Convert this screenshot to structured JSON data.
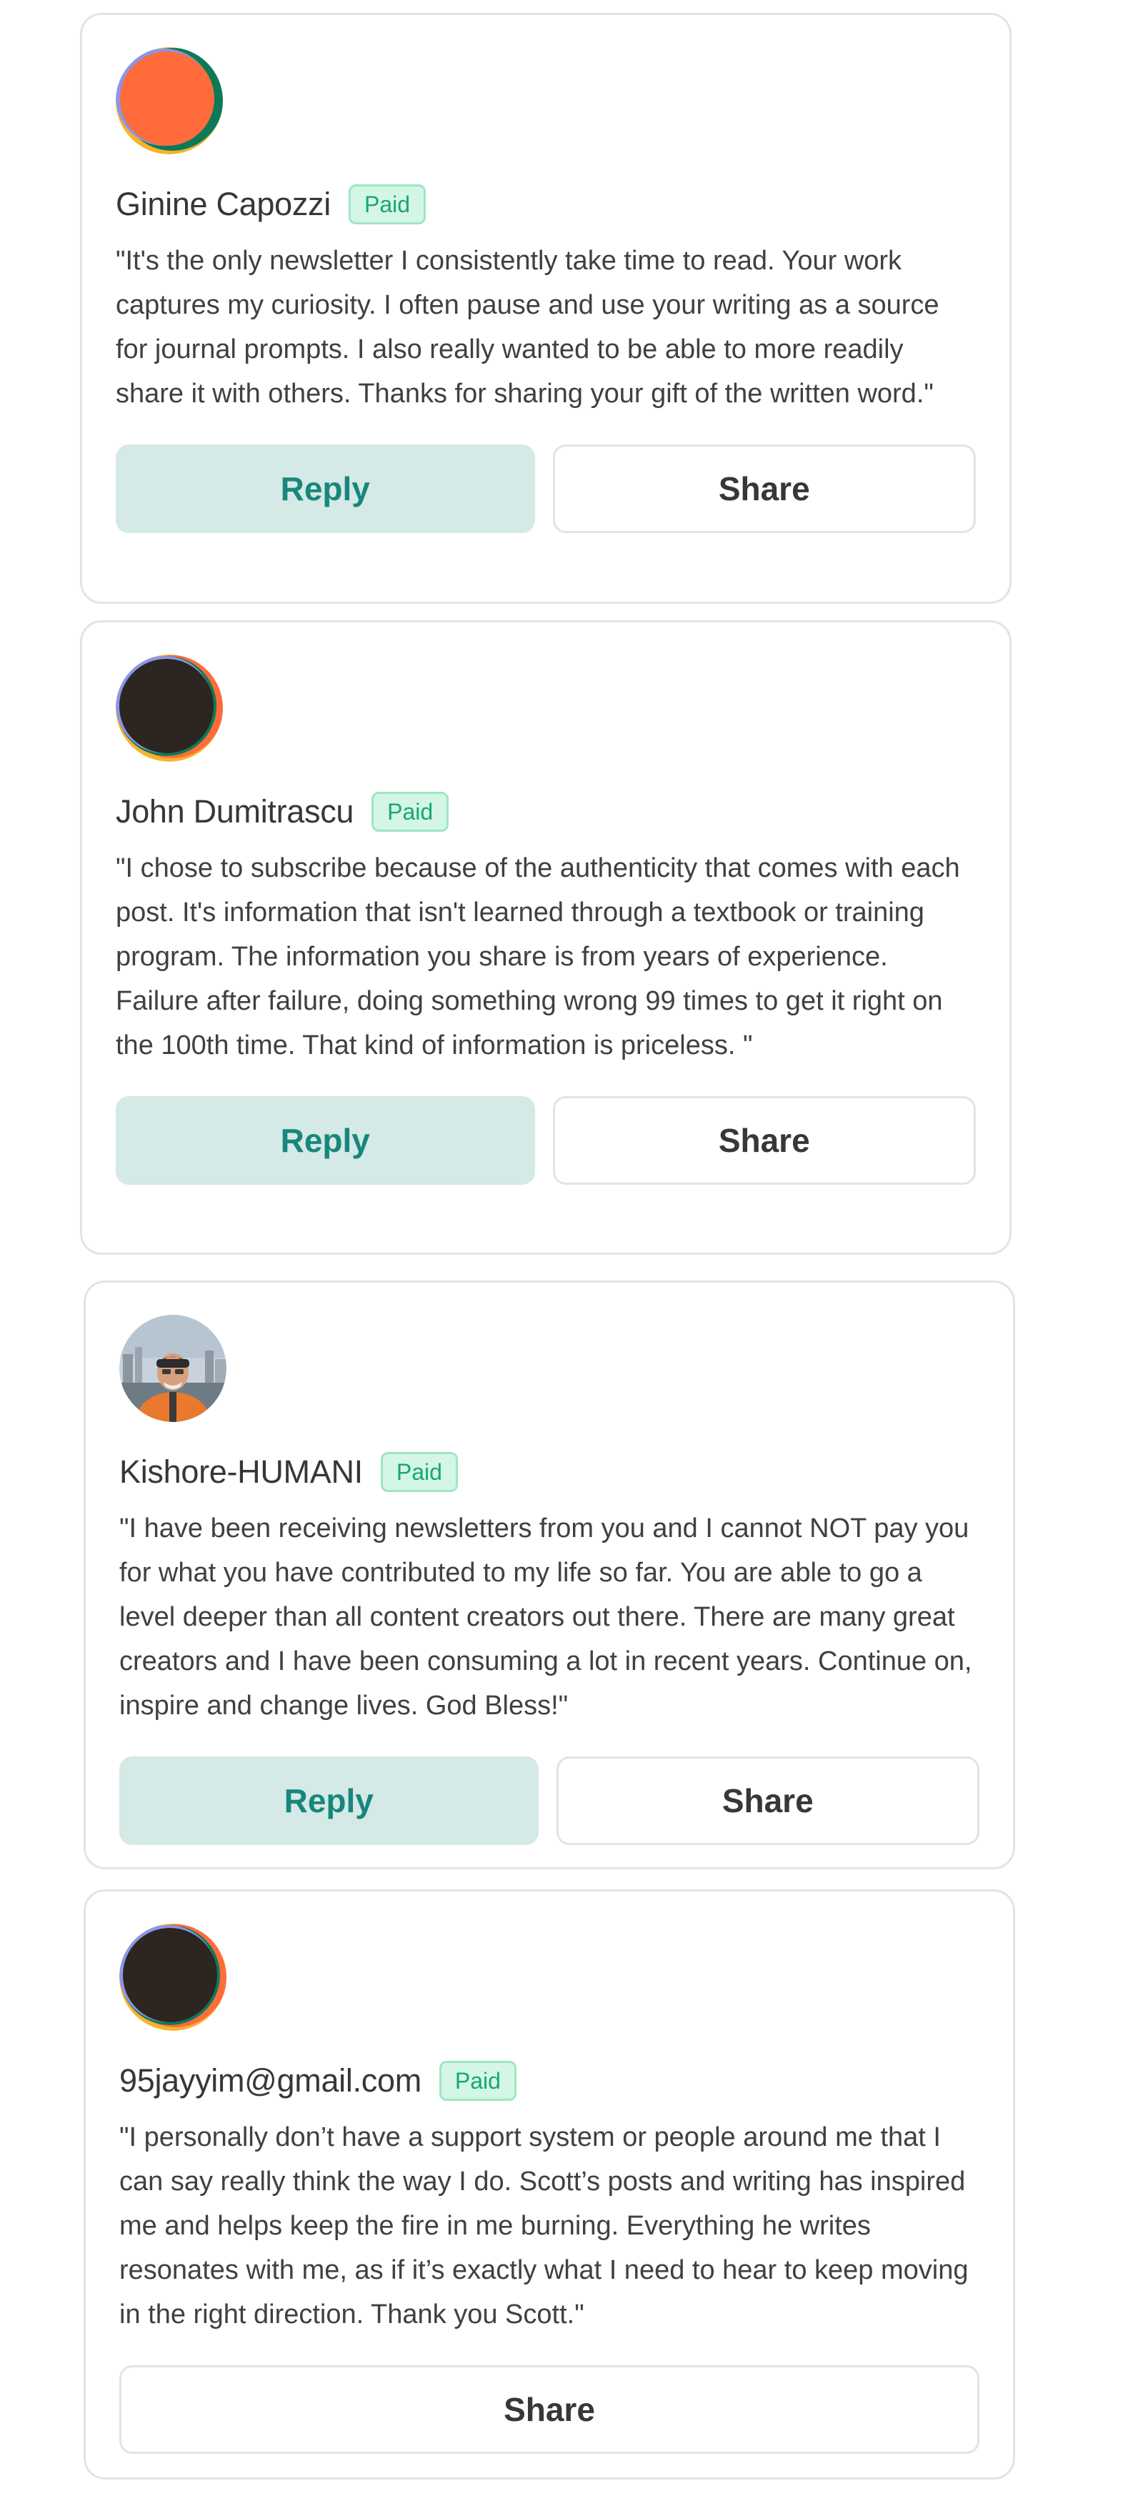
{
  "comments": [
    {
      "name": "Ginine Capozzi",
      "badge": "Paid",
      "quote": "\"It's the only newsletter I consistently take time to read. Your work captures my curiosity. I often pause and use your writing as a source for journal prompts. I also really wanted to be able to more readily share it with others. Thanks for sharing your gift of the written word.\"",
      "reply_label": "Reply",
      "share_label": "Share",
      "avatar": {
        "icon": "default-avatar-icon",
        "main_color": "#ff6b3a"
      }
    },
    {
      "name": "John Dumitrascu",
      "badge": "Paid",
      "quote": "\"I chose to subscribe because of the authenticity that comes with each post. It's information that isn't learned through a textbook or training program. The information you share is from years of experience. Failure after failure, doing something wrong 99 times to get it right on the 100th time. That kind of information is priceless. \"",
      "reply_label": "Reply",
      "share_label": "Share",
      "avatar": {
        "icon": "default-avatar-icon",
        "main_color": "#2c2520"
      }
    },
    {
      "name": "Kishore-HUMANI",
      "badge": "Paid",
      "quote": "\"I have been receiving newsletters from you and I cannot NOT pay you for what you have contributed to my life so far. You are able to go a level deeper than all content creators out there. There are many great creators and I have been consuming a lot in recent years. Continue on, inspire and change lives. God Bless!\"",
      "reply_label": "Reply",
      "share_label": "Share",
      "avatar": {
        "icon": "photo-avatar-icon"
      }
    },
    {
      "name": "95jayyim@gmail.com",
      "badge": "Paid",
      "quote": "\"I personally don’t have a support system or people around me that I can say really think the way I do. Scott’s posts and writing has inspired me and helps keep the fire in me burning. Everything he writes resonates with me, as if it’s exactly what I need to hear to keep moving in the right direction. Thank you Scott.\"",
      "share_label": "Share",
      "avatar": {
        "icon": "default-avatar-icon",
        "main_color": "#2c2520"
      }
    }
  ],
  "colors": {
    "accent": "#17877c",
    "reply_bg": "#d5e9e6",
    "badge_bg": "#d4f6e6",
    "badge_text": "#17a86c",
    "border": "#e3e3e3"
  }
}
